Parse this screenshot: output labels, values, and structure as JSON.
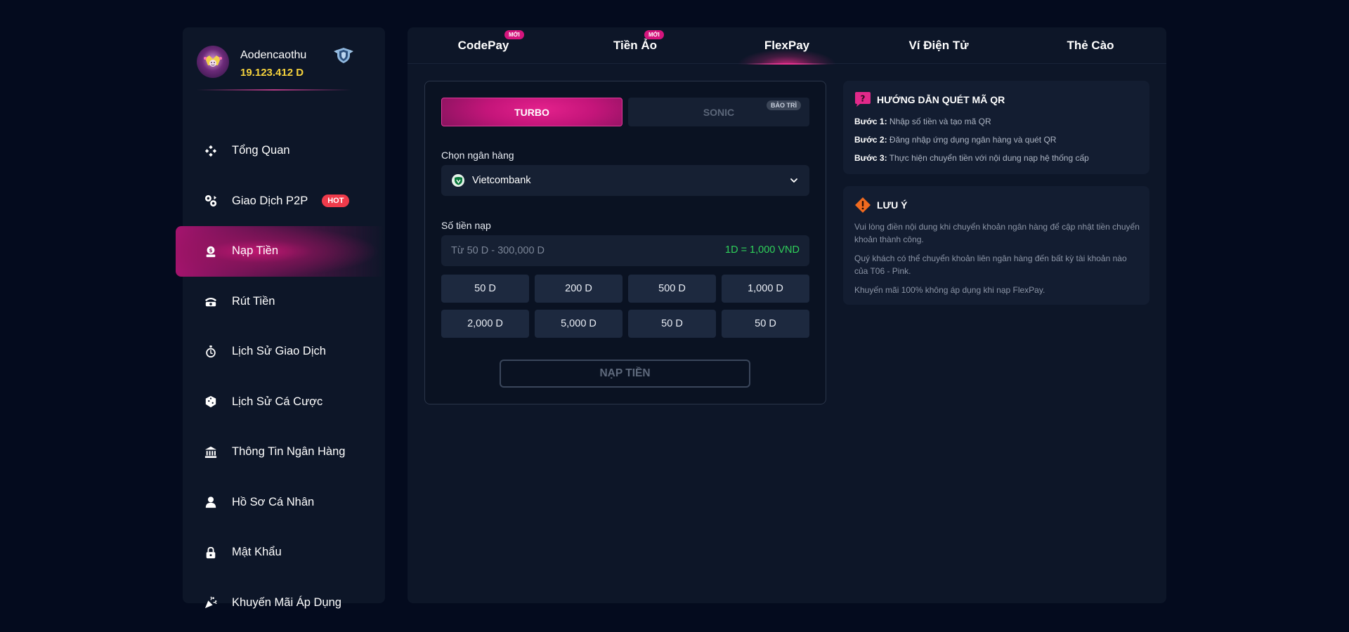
{
  "profile": {
    "username": "Aodencaothu",
    "balance": "19.123.412 D"
  },
  "sidebar": {
    "items": [
      {
        "label": "Tổng Quan",
        "icon": "diamonds-icon"
      },
      {
        "label": "Giao Dịch P2P",
        "icon": "coins-exchange-icon",
        "badge": "HOT"
      },
      {
        "label": "Nạp Tiền",
        "icon": "deposit-icon",
        "active": true
      },
      {
        "label": "Rút Tiền",
        "icon": "withdraw-icon"
      },
      {
        "label": "Lịch Sử Giao Dịch",
        "icon": "stopwatch-icon"
      },
      {
        "label": "Lịch Sử Cá Cược",
        "icon": "dice-icon"
      },
      {
        "label": "Thông Tin Ngân Hàng",
        "icon": "bank-icon"
      },
      {
        "label": "Hồ Sơ Cá Nhân",
        "icon": "user-icon"
      },
      {
        "label": "Mật Khẩu",
        "icon": "lock-icon"
      },
      {
        "label": "Khuyến Mãi Áp Dụng",
        "icon": "confetti-icon"
      }
    ]
  },
  "tabs": [
    {
      "label": "CodePay",
      "badge": "MỚI"
    },
    {
      "label": "Tiền Ảo",
      "badge": "MỚI"
    },
    {
      "label": "FlexPay",
      "active": true
    },
    {
      "label": "Ví Điện Tử"
    },
    {
      "label": "Thẻ Cào"
    }
  ],
  "form": {
    "turbo_label": "TURBO",
    "sonic_label": "SONIC",
    "sonic_badge": "BẢO TRÌ",
    "bank_label": "Chọn ngân hàng",
    "bank_selected": "Vietcombank",
    "amount_label": "Số tiền nạp",
    "amount_placeholder": "Từ 50 D - 300,000 D",
    "rate": "1D = 1,000 VND",
    "chips": [
      "50 D",
      "200 D",
      "500 D",
      "1,000 D",
      "2,000 D",
      "5,000 D",
      "50 D",
      "50 D"
    ],
    "submit_label": "NẠP TIỀN"
  },
  "guide": {
    "title": "HƯỚNG DẪN QUÉT MÃ QR",
    "steps": [
      {
        "label": "Bước 1:",
        "text": " Nhập số tiền và tạo mã QR"
      },
      {
        "label": "Bước 2:",
        "text": " Đăng nhập ứng dụng ngân hàng và quét QR"
      },
      {
        "label": "Bước 3:",
        "text": " Thực hiện chuyển tiền với nội dung nạp hệ thống cấp"
      }
    ]
  },
  "note": {
    "title": "LƯU Ý",
    "paragraphs": [
      "Vui lòng điền nội dung khi chuyển khoản ngân hàng để cập nhật tiền chuyển khoản thành công.",
      "Quý khách có thể chuyển khoản liên ngân hàng đến bất kỳ tài khoản nào của T06 - Pink.",
      "Khuyến mãi 100% không áp dụng khi nạp FlexPay."
    ]
  },
  "colors": {
    "background": "#040b1e",
    "panel": "#0d1628",
    "accent": "#e2298a",
    "balance": "#f5d23c",
    "rate": "#2fd05a",
    "hot": "#ef3b4b"
  }
}
